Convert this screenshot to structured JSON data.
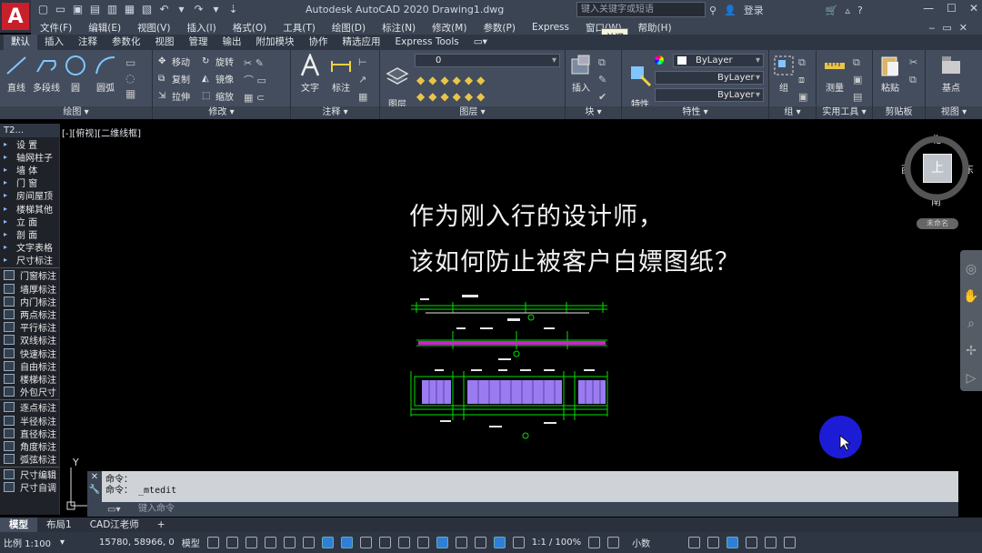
{
  "app": {
    "logo": "A",
    "title": "Autodesk AutoCAD 2020    Drawing1.dwg",
    "search_placeholder": "键入关键字或短语",
    "login": "登录",
    "help": "?"
  },
  "menu": [
    "文件(F)",
    "编辑(E)",
    "视图(V)",
    "插入(I)",
    "格式(O)",
    "工具(T)",
    "绘图(D)",
    "标注(N)",
    "修改(M)",
    "参数(P)",
    "Express",
    "窗口(W)",
    "帮助(H)"
  ],
  "tooltip": "关闭",
  "ribbon_tabs": [
    "默认",
    "插入",
    "注释",
    "参数化",
    "视图",
    "管理",
    "输出",
    "附加模块",
    "协作",
    "精选应用",
    "Express Tools"
  ],
  "ribbon": {
    "draw": {
      "title": "绘图",
      "line": "直线",
      "polyline": "多段线",
      "circle": "圆",
      "arc": "圆弧"
    },
    "modify": {
      "title": "修改",
      "move": "移动",
      "rotate": "旋转",
      "copy": "复制",
      "mirror": "镜像",
      "stretch": "拉伸",
      "scale": "缩放"
    },
    "annotation": {
      "title": "注释",
      "text": "文字",
      "dim": "标注"
    },
    "layers": {
      "title": "图层",
      "props": "图层\n特性",
      "current": "0"
    },
    "block": {
      "title": "块",
      "insert": "插入"
    },
    "properties": {
      "title": "特性",
      "match": "特性\n匹配",
      "color": "ByLayer",
      "linetype": "ByLayer",
      "lineweight": "ByLayer"
    },
    "groups": {
      "title": "组",
      "group": "组"
    },
    "utilities": {
      "title": "实用工具",
      "measure": "测量"
    },
    "clipboard": {
      "title": "剪贴板",
      "paste": "粘贴"
    },
    "view": {
      "title": "视图",
      "base": "基点"
    }
  },
  "palette": {
    "title": "T2...",
    "items": [
      "设    置",
      "轴网柱子",
      "墙    体",
      "门    窗",
      "房间屋顶",
      "楼梯其他",
      "立    面",
      "剖    面",
      "文字表格",
      "尺寸标注",
      "门窗标注",
      "墙厚标注",
      "内门标注",
      "两点标注",
      "平行标注",
      "双线标注",
      "快速标注",
      "自由标注",
      "楼梯标注",
      "外包尺寸",
      "逐点标注",
      "半径标注",
      "直径标注",
      "角度标注",
      "弧弦标注",
      "尺寸编辑",
      "尺寸自调"
    ]
  },
  "viewport_label": "[-][俯视][二维线框]",
  "headline": {
    "line1": "作为刚入行的设计师，",
    "line2": "该如何防止被客户白嫖图纸？"
  },
  "viewcube": {
    "north": "北",
    "south": "南",
    "west": "西",
    "east": "东",
    "face": "上",
    "wcs": "未命名"
  },
  "ucs": {
    "y": "Y",
    "x": "X"
  },
  "command": {
    "line1": "命令：",
    "line2": "命令： _mtedit",
    "placeholder": "键入命令"
  },
  "layout_tabs": [
    "模型",
    "布局1",
    "CAD江老师",
    "+"
  ],
  "status": {
    "scale": "比例 1:100",
    "coords": "15780, 58966, 0",
    "model": "模型",
    "annoscale": "1:1 / 100%",
    "units": "小数"
  },
  "colors": {
    "accent": "#2f7fd6",
    "cad_red": "#c8202b",
    "cursor_blue": "#1c1cd6",
    "drawing_green": "#00e000",
    "drawing_magenta": "#d020d0",
    "drawing_purple": "#9a7cf0"
  }
}
